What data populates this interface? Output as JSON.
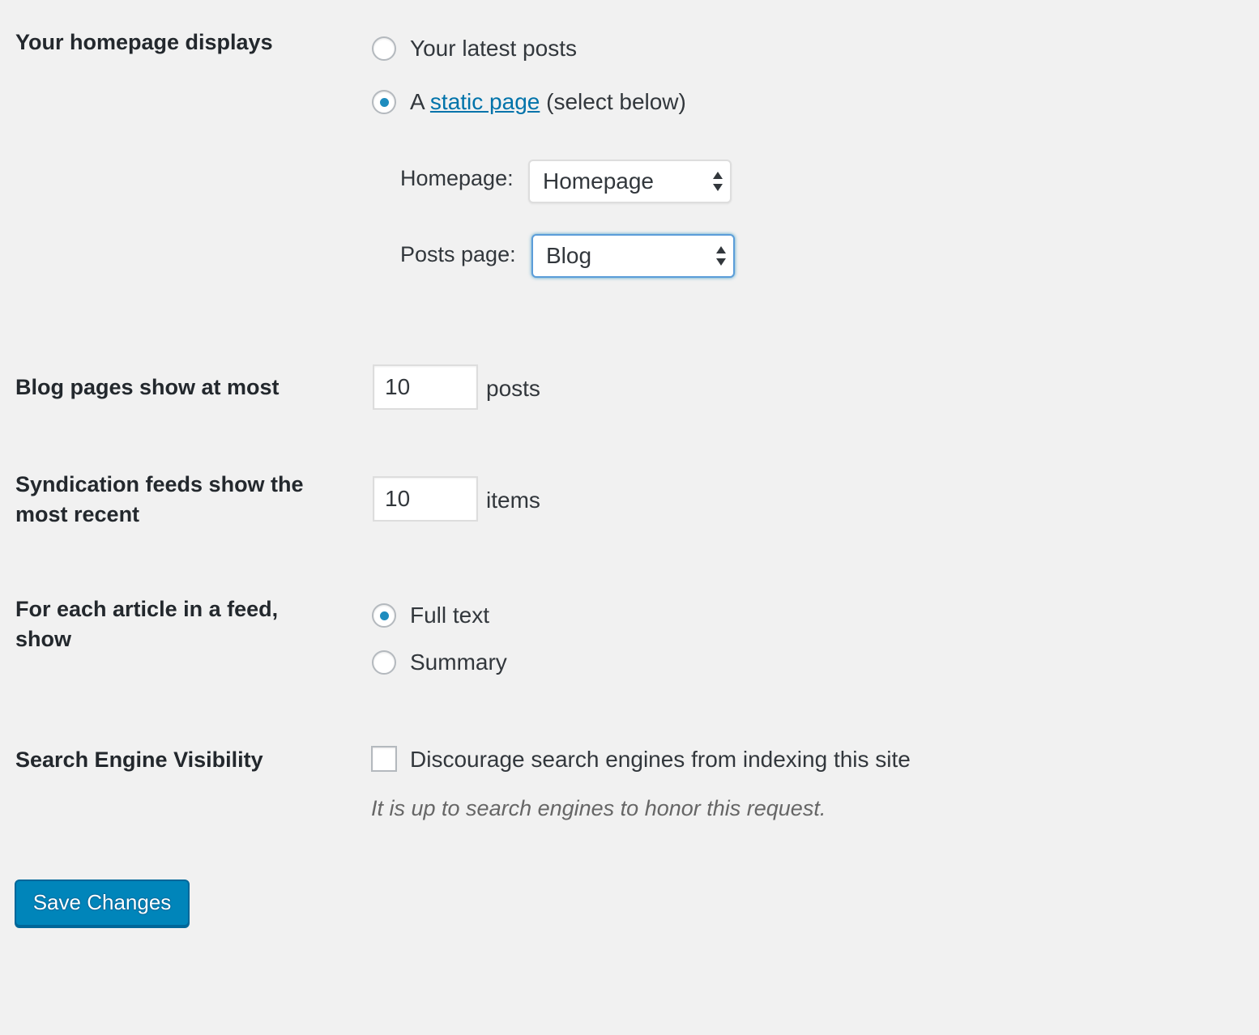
{
  "homepage_displays": {
    "label": "Your homepage displays",
    "option_latest": "Your latest posts",
    "option_static_prefix": "A",
    "option_static_link": "static page",
    "option_static_suffix": "(select below)",
    "selected": "static",
    "homepage_label": "Homepage:",
    "homepage_value": "Homepage",
    "posts_page_label": "Posts page:",
    "posts_page_value": "Blog"
  },
  "blog_pages": {
    "label": "Blog pages show at most",
    "value": "10",
    "unit": "posts"
  },
  "syndication": {
    "label_line1": "Syndication feeds show the",
    "label_line2": "most recent",
    "value": "10",
    "unit": "items"
  },
  "feed_article": {
    "label_line1": "For each article in a feed,",
    "label_line2": "show",
    "option_full": "Full text",
    "option_summary": "Summary",
    "selected": "full"
  },
  "search_visibility": {
    "label": "Search Engine Visibility",
    "checkbox_label": "Discourage search engines from indexing this site",
    "checked": false,
    "description": "It is up to search engines to honor this request."
  },
  "save_button": {
    "label": "Save Changes"
  },
  "colors": {
    "background": "#f1f1f1",
    "link": "#0073aa",
    "radio_dot": "#1e8cbe",
    "primary_button": "#0085ba",
    "focus_border": "#5b9dd9"
  }
}
